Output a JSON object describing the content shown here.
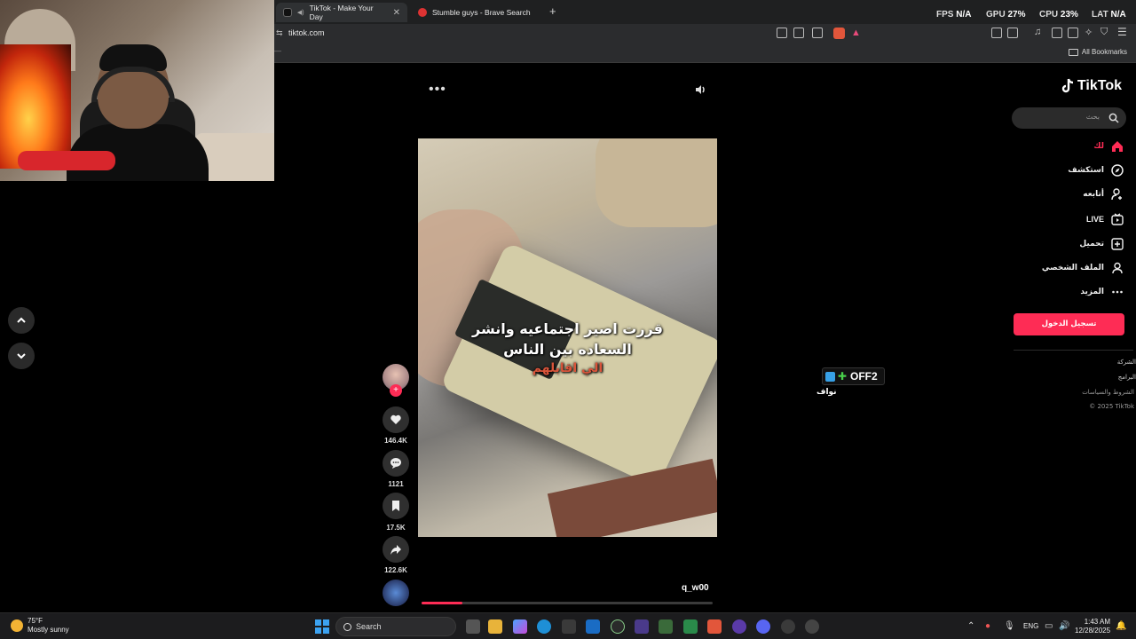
{
  "browser": {
    "tabs": [
      {
        "label": "TikTok - Make Your Day"
      },
      {
        "label": "Stumble guys - Brave Search"
      }
    ],
    "new_tab": "+",
    "url": "tiktok.com",
    "bookmarks_label": "All Bookmarks"
  },
  "hud": {
    "fps_label": "FPS",
    "fps": "N/A",
    "gpu_label": "GPU",
    "gpu": "27%",
    "cpu_label": "CPU",
    "cpu": "23%",
    "lat_label": "LAT",
    "lat": "N/A"
  },
  "video": {
    "caption_lines": [
      "قررت اصير اجتماعيه وانشر",
      "السعاده بين الناس",
      "الي اقابلهم"
    ],
    "username": "q_w00",
    "progress_fraction": 0.14,
    "more_glyph": "•••"
  },
  "actions": {
    "likes": "146.4K",
    "comments": "1121",
    "saves": "17.5K",
    "shares": "122.6K",
    "follow_glyph": "+"
  },
  "overlay": {
    "badge_text": "OFF2",
    "sub_text": "نواف"
  },
  "sidebar": {
    "logo": "TikTok",
    "search_placeholder": "بحث",
    "nav": [
      {
        "label": "لك",
        "icon": "home-icon"
      },
      {
        "label": "استكشف",
        "icon": "compass-icon"
      },
      {
        "label": "أتابعه",
        "icon": "follow-icon"
      },
      {
        "label": "LIVE",
        "icon": "live-icon"
      },
      {
        "label": "تحميل",
        "icon": "upload-icon"
      },
      {
        "label": "الملف الشخصي",
        "icon": "profile-icon"
      },
      {
        "label": "المزيد",
        "icon": "more-icon"
      }
    ],
    "login_label": "تسجيل الدخول",
    "footer": [
      "الشركة",
      "البرامج",
      "الشروط والسياسات",
      "© 2025 TikTok"
    ]
  },
  "taskbar": {
    "weather_temp": "75°F",
    "weather_desc": "Mostly sunny",
    "search_label": "Search",
    "lang": "ENG",
    "time": "1:43 AM",
    "date": "12/28/2025"
  },
  "colors": {
    "accent": "#fe2c55",
    "background": "#000000",
    "chrome": "#2b2c2e"
  }
}
